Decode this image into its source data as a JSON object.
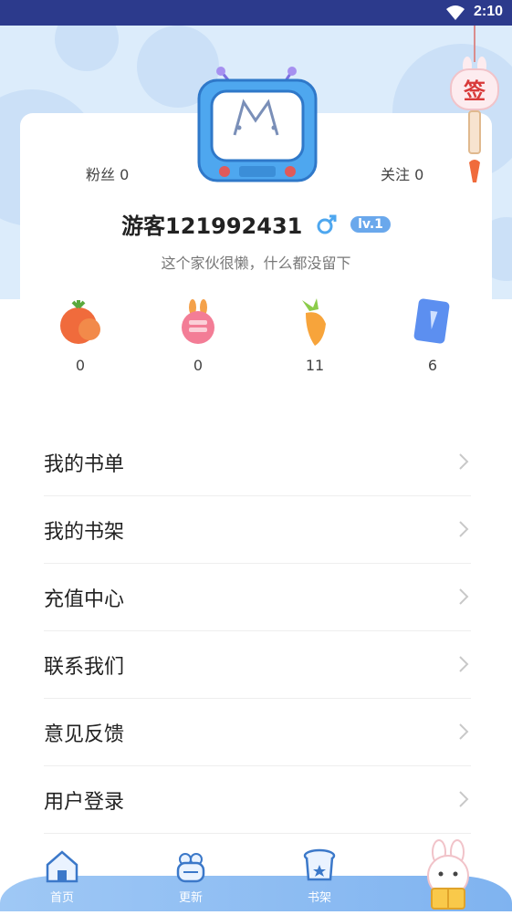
{
  "status_bar": {
    "time": "2:10"
  },
  "sign_in": {
    "label": "签"
  },
  "profile": {
    "fans_label": "粉丝 0",
    "follows_label": "关注 0",
    "username": "游客121992431",
    "level": "lv.1",
    "bio": "这个家伙很懒，什么都没留下"
  },
  "stats": [
    {
      "icon": "tomato-icon",
      "value": "0"
    },
    {
      "icon": "rabbit-coin-icon",
      "value": "0"
    },
    {
      "icon": "carrot-icon",
      "value": "11"
    },
    {
      "icon": "ticket-icon",
      "value": "6"
    }
  ],
  "menu": [
    {
      "label": "我的书单"
    },
    {
      "label": "我的书架"
    },
    {
      "label": "充值中心"
    },
    {
      "label": "联系我们"
    },
    {
      "label": "意见反馈"
    },
    {
      "label": "用户登录"
    }
  ],
  "tabs": [
    {
      "label": "首页",
      "icon": "home-icon"
    },
    {
      "label": "更新",
      "icon": "update-icon"
    },
    {
      "label": "书架",
      "icon": "bookshelf-icon"
    },
    {
      "label": "",
      "icon": "mine-rabbit-icon"
    }
  ],
  "colors": {
    "status_bar": "#2c3a8c",
    "hero_bg": "#dcecfb",
    "accent": "#6aa8ec",
    "tab_bar": "#8cbdf2"
  }
}
